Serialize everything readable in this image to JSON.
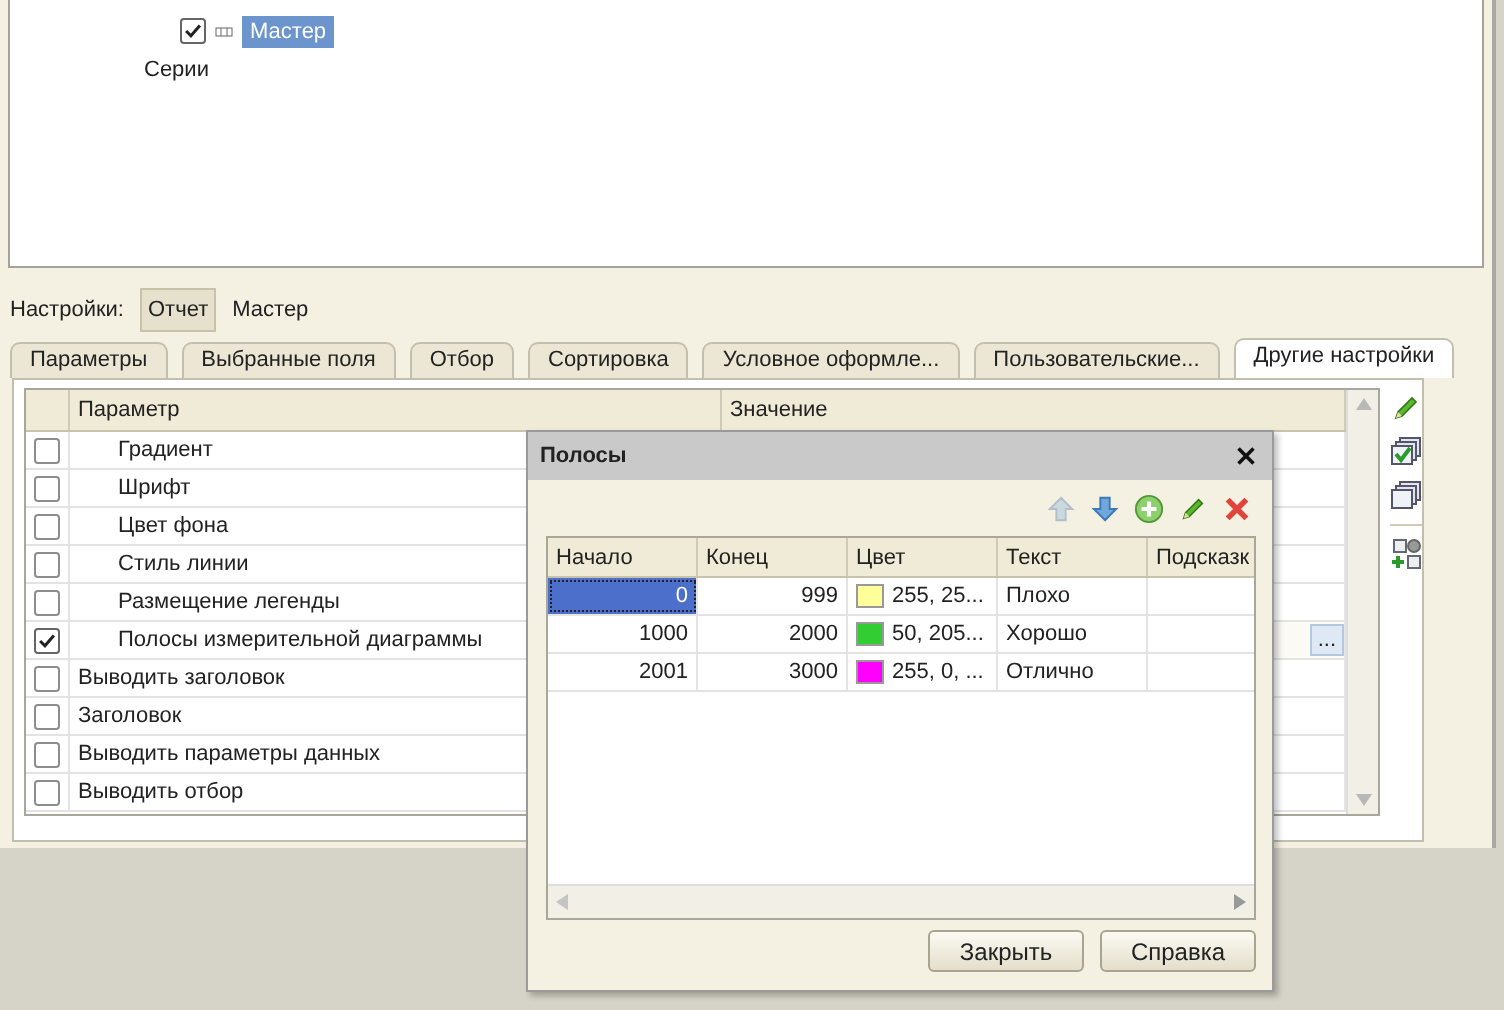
{
  "tree": [
    {
      "label": "Мастер",
      "kind": "check",
      "checked": true,
      "selected": true
    },
    {
      "label": "Серии",
      "kind": "plain",
      "selected": false
    }
  ],
  "settings": {
    "label": "Настройки:",
    "options": [
      {
        "label": "Отчет",
        "selected": true
      },
      {
        "label": "Мастер",
        "selected": false
      }
    ]
  },
  "tabs": [
    {
      "label": "Параметры",
      "selected": false
    },
    {
      "label": "Выбранные поля",
      "selected": false
    },
    {
      "label": "Отбор",
      "selected": false
    },
    {
      "label": "Сортировка",
      "selected": false
    },
    {
      "label": "Условное оформле...",
      "selected": false
    },
    {
      "label": "Пользовательские...",
      "selected": false
    },
    {
      "label": "Другие настройки",
      "selected": true
    }
  ],
  "params": {
    "columns": [
      "Параметр",
      "Значение"
    ],
    "rows": [
      {
        "label": "Градиент",
        "kind": "nested",
        "checked": false
      },
      {
        "label": "Шрифт",
        "kind": "nested",
        "checked": false
      },
      {
        "label": "Цвет фона",
        "kind": "nested",
        "checked": false
      },
      {
        "label": "Стиль линии",
        "kind": "nested",
        "checked": false
      },
      {
        "label": "Размещение легенды",
        "kind": "nested",
        "checked": false
      },
      {
        "label": "Полосы измерительной диаграммы",
        "kind": "nested",
        "checked": true,
        "value_button": "..."
      },
      {
        "label": "Выводить заголовок",
        "kind": "top",
        "checked": false
      },
      {
        "label": "Заголовок",
        "kind": "top",
        "checked": false
      },
      {
        "label": "Выводить параметры данных",
        "kind": "top",
        "checked": false
      },
      {
        "label": "Выводить отбор",
        "kind": "top",
        "checked": false
      }
    ]
  },
  "side_tools": [
    {
      "kind": "pencil"
    },
    {
      "kind": "stack-check"
    },
    {
      "kind": "stack"
    },
    {
      "kind": "settings-add"
    }
  ],
  "dialog": {
    "title": "Полосы",
    "tools": [
      {
        "kind": "up",
        "disabled": true
      },
      {
        "kind": "down",
        "disabled": false
      },
      {
        "kind": "add",
        "disabled": false
      },
      {
        "kind": "pencil",
        "disabled": false
      },
      {
        "kind": "delete",
        "disabled": false
      }
    ],
    "columns": [
      "Начало",
      "Конец",
      "Цвет",
      "Текст",
      "Подсказк"
    ],
    "rows": [
      {
        "start": "0",
        "end": "999",
        "color": "#ffff99",
        "color_text": "255, 25...",
        "text": "Плохо",
        "selected": true
      },
      {
        "start": "1000",
        "end": "2000",
        "color": "#32cd32",
        "color_text": "50, 205...",
        "text": "Хорошо",
        "selected": false
      },
      {
        "start": "2001",
        "end": "3000",
        "color": "#ff00ff",
        "color_text": "255, 0, ...",
        "text": "Отлично",
        "selected": false
      }
    ],
    "buttons": [
      "Закрыть",
      "Справка"
    ]
  }
}
